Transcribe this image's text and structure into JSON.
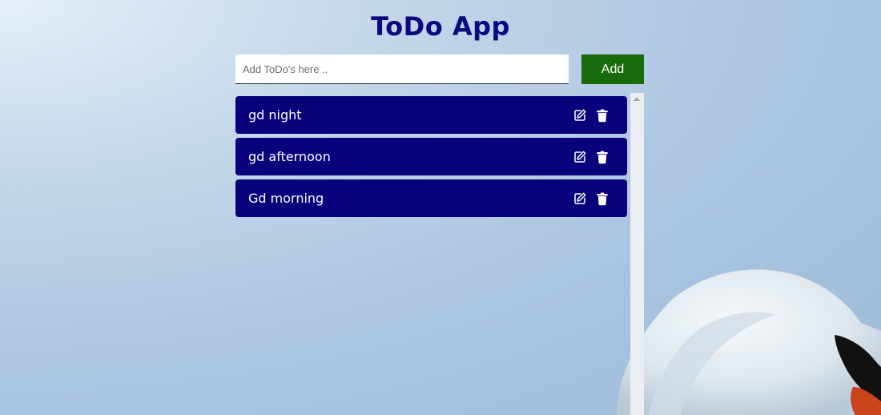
{
  "app": {
    "title": "ToDo App"
  },
  "input": {
    "placeholder": "Add ToDo's here ..",
    "value": ""
  },
  "add_button": {
    "label": "Add"
  },
  "todos": [
    {
      "text": "gd night"
    },
    {
      "text": "gd afternoon"
    },
    {
      "text": "Gd morning"
    }
  ],
  "icons": {
    "edit": "edit-icon",
    "delete": "trash-icon"
  },
  "colors": {
    "title": "#0a0a7e",
    "todo_item_bg": "#09017c",
    "add_button_bg": "#186b0a",
    "item_text": "#ffffff"
  }
}
